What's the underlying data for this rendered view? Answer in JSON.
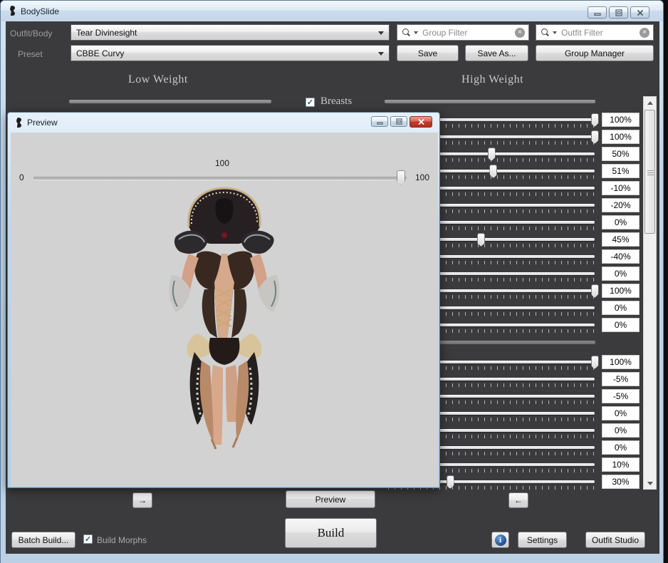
{
  "window": {
    "title": "BodySlide",
    "controls": {
      "minimize": "minimize",
      "maximize": "maximize",
      "close": "close"
    }
  },
  "toolbar": {
    "outfit_label": "Outfit/Body",
    "outfit_value": "Tear Divinesight",
    "preset_label": "Preset",
    "preset_value": "CBBE Curvy",
    "group_filter_placeholder": "Group Filter",
    "outfit_filter_placeholder": "Outfit Filter",
    "save_label": "Save",
    "save_as_label": "Save As...",
    "group_manager_label": "Group Manager",
    "clear_glyph": "×"
  },
  "weights": {
    "low": "Low Weight",
    "high": "High Weight"
  },
  "category": {
    "name": "Breasts",
    "checked": true,
    "check_glyph": "✓"
  },
  "sliders": {
    "range": [
      0,
      100
    ],
    "group1": [
      {
        "label": "100%",
        "value": 100
      },
      {
        "label": "100%",
        "value": 100
      },
      {
        "label": "50%",
        "value": 50
      },
      {
        "label": "51%",
        "value": 51
      },
      {
        "label": "-10%",
        "value": -10
      },
      {
        "label": "-20%",
        "value": -20
      },
      {
        "label": "0%",
        "value": 0
      },
      {
        "label": "45%",
        "value": 45
      },
      {
        "label": "-40%",
        "value": -40
      },
      {
        "label": "0%",
        "value": 0
      },
      {
        "label": "100%",
        "value": 100
      },
      {
        "label": "0%",
        "value": 0
      },
      {
        "label": "0%",
        "value": 0
      }
    ],
    "group2": [
      {
        "label": "100%",
        "value": 100
      },
      {
        "label": "-5%",
        "value": -5
      },
      {
        "label": "-5%",
        "value": -5
      },
      {
        "label": "0%",
        "value": 0
      },
      {
        "label": "0%",
        "value": 0
      },
      {
        "label": "0%",
        "value": 0
      },
      {
        "label": "10%",
        "value": 10
      },
      {
        "label": "30%",
        "value": 30
      }
    ]
  },
  "preview_window": {
    "title": "Preview",
    "slider_value": "100",
    "slider_min": "0",
    "slider_max": "100"
  },
  "footer": {
    "to_high_arrow": "→",
    "to_low_arrow": "←",
    "preview_label": "Preview",
    "build_label": "Build",
    "batch_build_label": "Batch Build...",
    "build_morphs_label": "Build Morphs",
    "build_morphs_checked": true,
    "info_glyph": "i",
    "settings_label": "Settings",
    "outfit_studio_label": "Outfit Studio"
  },
  "colors": {
    "client_bg": "#3b3b3d",
    "aero_border": "#bcd0e5",
    "close_button_red": "#c03a28",
    "accent_check_blue": "#2b579a",
    "preview_bg": "#d2d2d2"
  },
  "icons": {
    "app_icon": "bodyslide-figure",
    "search_icon": "magnifier-with-dropdown",
    "clear_icon": "circle-x",
    "info_icon": "info-circle-blue"
  }
}
